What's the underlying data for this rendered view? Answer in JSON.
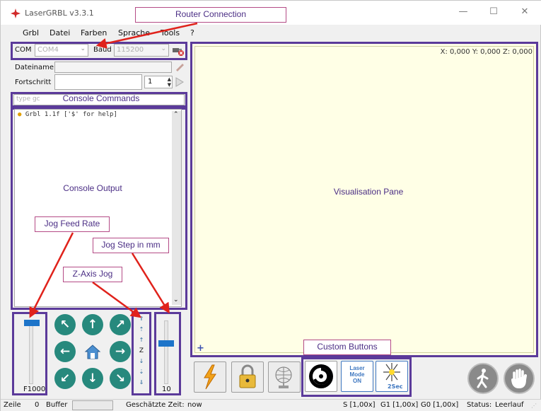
{
  "window": {
    "title": "LaserGRBL v3.3.1",
    "minimize": "—",
    "maximize": "☐",
    "close": "✕"
  },
  "menu": {
    "items": [
      "Grbl",
      "Datei",
      "Farben",
      "Sprache",
      "Tools",
      "?"
    ]
  },
  "connection": {
    "com_label": "COM",
    "com_value": "COM4",
    "baud_label": "Baud",
    "baud_value": "115200"
  },
  "file": {
    "filename_label": "Dateiname",
    "progress_label": "Fortschritt",
    "copies_value": "1"
  },
  "console": {
    "input_placeholder": "type gc",
    "lines": [
      "Grbl 1.1f ['$' for help]"
    ]
  },
  "jog": {
    "feed_label": "F1000",
    "step_label": "10",
    "z_label": "Z",
    "feed_level": 0.15,
    "step_level": 0.35
  },
  "visual": {
    "coords": "X: 0,000 Y: 0,000 Z: 0,000"
  },
  "custom_buttons": {
    "laser_mode_text": [
      "Laser",
      "Mode",
      "ON"
    ],
    "timer_text": "2Sec"
  },
  "annotations": {
    "router": "Router Connection",
    "console_commands": "Console Commands",
    "console_output": "Console Output",
    "jog_feed": "Jog Feed Rate",
    "jog_step": "Jog Step in mm",
    "z_axis": "Z-Axis Jog",
    "visual_pane": "Visualisation Pane",
    "custom": "Custom Buttons"
  },
  "status": {
    "line_label": "Zeile",
    "line_value": "0",
    "buffer_label": "Buffer",
    "est_label": "Geschätzte Zeit:",
    "est_value": "now",
    "s_override": "S [1,00x]",
    "g1_override": "G1 [1,00x]",
    "g0_override": "G0 [1,00x]",
    "status_label": "Status:",
    "status_value": "Leerlauf"
  },
  "colors": {
    "accent": "#5b3a9a",
    "callout_border": "#b44b86",
    "jog_button": "#27897d",
    "pane_bg": "#ffffe6",
    "arrow": "#e0221b"
  }
}
